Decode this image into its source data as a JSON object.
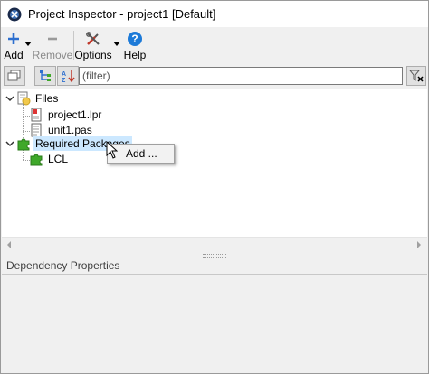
{
  "window": {
    "title": "Project Inspector - project1 [Default]"
  },
  "toolbar": {
    "add_label": "Add",
    "remove_label": "Remove",
    "options_label": "Options",
    "help_label": "Help"
  },
  "filter": {
    "placeholder": "(filter)"
  },
  "tree": {
    "files_label": "Files",
    "file_items": [
      "project1.lpr",
      "unit1.pas"
    ],
    "required_packages_label": "Required Packages",
    "package_items": [
      "LCL"
    ]
  },
  "context_menu": {
    "add_item": "Add ..."
  },
  "dependency_panel": {
    "label": "Dependency Properties"
  },
  "colors": {
    "selection": "#cce8ff",
    "help_blue": "#1c7ad8",
    "package_green": "#3fa82a"
  }
}
